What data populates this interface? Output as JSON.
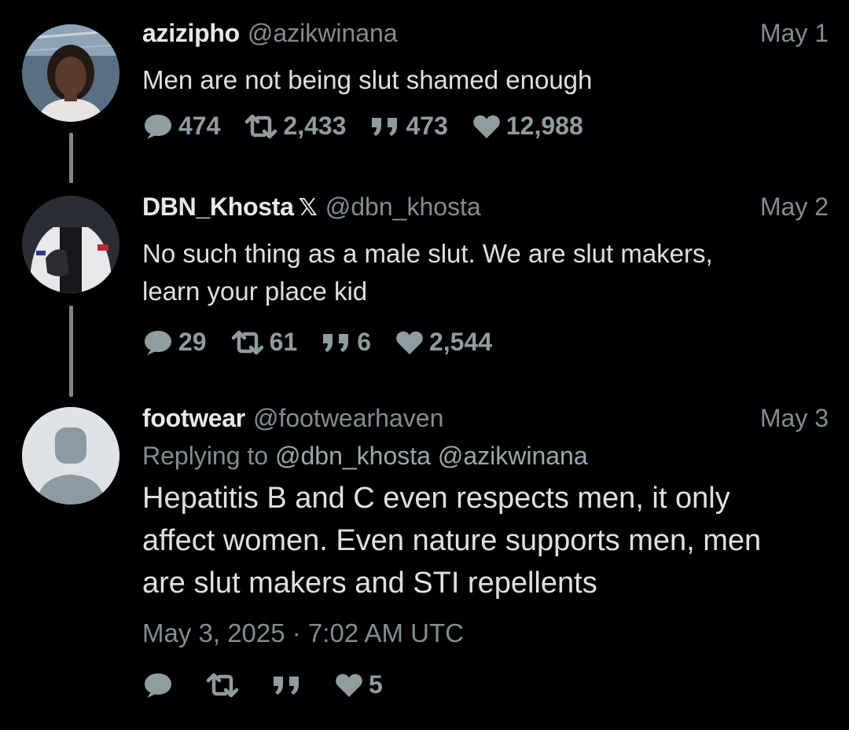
{
  "colors": {
    "background": "#000000",
    "text": "#dde1e3",
    "secondary": "#808e92",
    "icon": "#8f9ca0",
    "connector": "#7b8a8e"
  },
  "tweets": [
    {
      "display_name": "azizipho",
      "handle": "@azikwinana",
      "date": "May 1",
      "text": "Men are not being slut shamed enough",
      "stats": {
        "replies": "474",
        "retweets": "2,433",
        "quotes": "473",
        "likes": "12,988"
      }
    },
    {
      "display_name": "DBN_Khosta",
      "badge": "𝕏",
      "handle": "@dbn_khosta",
      "date": "May 2",
      "text_lines": [
        "No such thing as a male slut. We are slut makers,",
        "learn your place kid"
      ],
      "stats": {
        "replies": "29",
        "retweets": "61",
        "quotes": "6",
        "likes": "2,544"
      }
    },
    {
      "display_name": "footwear",
      "handle": "@footwearhaven",
      "date": "May 3",
      "replying_to_label": "Replying to",
      "replying_to": [
        "@dbn_khosta",
        "@azikwinana"
      ],
      "text_lines": [
        "Hepatitis B and C even respects men, it only",
        "affect women. Even nature supports men, men",
        "are slut makers and STI repellents"
      ],
      "timestamp": "May 3, 2025 · 7:02 AM UTC",
      "stats": {
        "likes": "5"
      }
    }
  ],
  "icons": {
    "reply": "comment-bubble-icon",
    "retweet": "retweet-icon",
    "quote": "quote-icon",
    "like": "heart-icon",
    "default_avatar": "default-avatar-icon"
  }
}
